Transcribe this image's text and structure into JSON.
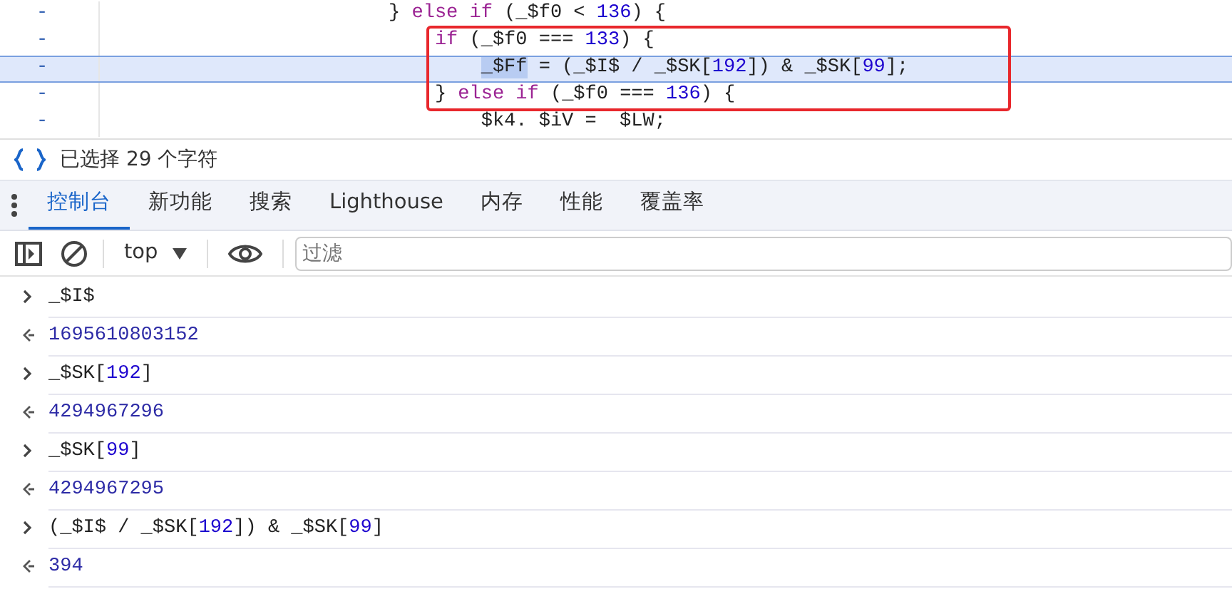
{
  "code_lines": [
    {
      "marker": "-",
      "selected": false,
      "tokens": [
        {
          "text": "                         } ",
          "kind": "plain"
        },
        {
          "text": "else if",
          "kind": "keyword"
        },
        {
          "text": " (_$f0 < ",
          "kind": "plain"
        },
        {
          "text": "136",
          "kind": "number"
        },
        {
          "text": ") {",
          "kind": "plain"
        }
      ]
    },
    {
      "marker": "-",
      "selected": false,
      "tokens": [
        {
          "text": "                             if",
          "kind": "keyword"
        },
        {
          "text": " (_$f0 === ",
          "kind": "plain"
        },
        {
          "text": "133",
          "kind": "number"
        },
        {
          "text": ") {",
          "kind": "plain"
        }
      ]
    },
    {
      "marker": "-",
      "selected": true,
      "tokens": [
        {
          "text": "                                 _$Ff",
          "kind": "match"
        },
        {
          "text": " = (_$I$ / _$SK[",
          "kind": "plain"
        },
        {
          "text": "192",
          "kind": "number"
        },
        {
          "text": "]) & _$SK[",
          "kind": "plain"
        },
        {
          "text": "99",
          "kind": "number"
        },
        {
          "text": "];",
          "kind": "plain"
        }
      ]
    },
    {
      "marker": "-",
      "selected": false,
      "tokens": [
        {
          "text": "                             } ",
          "kind": "plain"
        },
        {
          "text": "else if",
          "kind": "keyword"
        },
        {
          "text": " (_$f0 === ",
          "kind": "plain"
        },
        {
          "text": "136",
          "kind": "number"
        },
        {
          "text": ") {",
          "kind": "plain"
        }
      ]
    },
    {
      "marker": "-",
      "selected": false,
      "tokens": [
        {
          "text": "                                 $k4. $iV =  $LW;",
          "kind": "plain"
        }
      ]
    }
  ],
  "status_bar": {
    "text": "已选择 29 个字符"
  },
  "tabs": [
    {
      "label": "控制台",
      "selected": true
    },
    {
      "label": "新功能",
      "selected": false
    },
    {
      "label": "搜索",
      "selected": false
    },
    {
      "label": "Lighthouse",
      "selected": false
    },
    {
      "label": "内存",
      "selected": false
    },
    {
      "label": "性能",
      "selected": false
    },
    {
      "label": "覆盖率",
      "selected": false
    }
  ],
  "toolbar": {
    "context": "top",
    "filter": {
      "placeholder": "过滤"
    }
  },
  "console": [
    {
      "kind": "input",
      "tokens": [
        {
          "text": "_$I$",
          "kind": "plain"
        }
      ]
    },
    {
      "kind": "output",
      "tokens": [
        {
          "text": "1695610803152",
          "kind": "number"
        }
      ]
    },
    {
      "kind": "input",
      "tokens": [
        {
          "text": "_$SK[",
          "kind": "plain"
        },
        {
          "text": "192",
          "kind": "number"
        },
        {
          "text": "]",
          "kind": "plain"
        }
      ]
    },
    {
      "kind": "output",
      "tokens": [
        {
          "text": "4294967296",
          "kind": "number"
        }
      ]
    },
    {
      "kind": "input",
      "tokens": [
        {
          "text": "_$SK[",
          "kind": "plain"
        },
        {
          "text": "99",
          "kind": "number"
        },
        {
          "text": "]",
          "kind": "plain"
        }
      ]
    },
    {
      "kind": "output",
      "tokens": [
        {
          "text": "4294967295",
          "kind": "number"
        }
      ]
    },
    {
      "kind": "input",
      "tokens": [
        {
          "text": "(_$I$ / _$SK[",
          "kind": "plain"
        },
        {
          "text": "192",
          "kind": "number"
        },
        {
          "text": "]) & _$SK[",
          "kind": "plain"
        },
        {
          "text": "99",
          "kind": "number"
        },
        {
          "text": "]",
          "kind": "plain"
        }
      ]
    },
    {
      "kind": "output",
      "tokens": [
        {
          "text": "394",
          "kind": "number"
        }
      ]
    }
  ]
}
